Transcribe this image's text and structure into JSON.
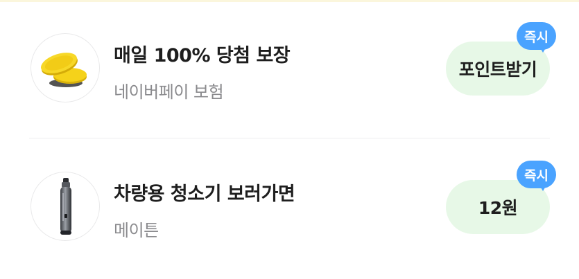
{
  "offers": [
    {
      "title": "매일 100% 당첨 보장",
      "sponsor": "네이버페이 보험",
      "reward_label": "포인트받기",
      "badge": "즉시",
      "thumbnail_icon": "gold-coins-icon"
    },
    {
      "title": "차량용 청소기 보러가면",
      "sponsor": "메이튼",
      "reward_label": "12원",
      "badge": "즉시",
      "thumbnail_icon": "handheld-vacuum-icon"
    }
  ],
  "colors": {
    "reward_bg": "#e7f8e7",
    "badge_bg": "#4aa3ff",
    "title_text": "#1e1e1e",
    "sub_text": "#8a8a8d"
  }
}
